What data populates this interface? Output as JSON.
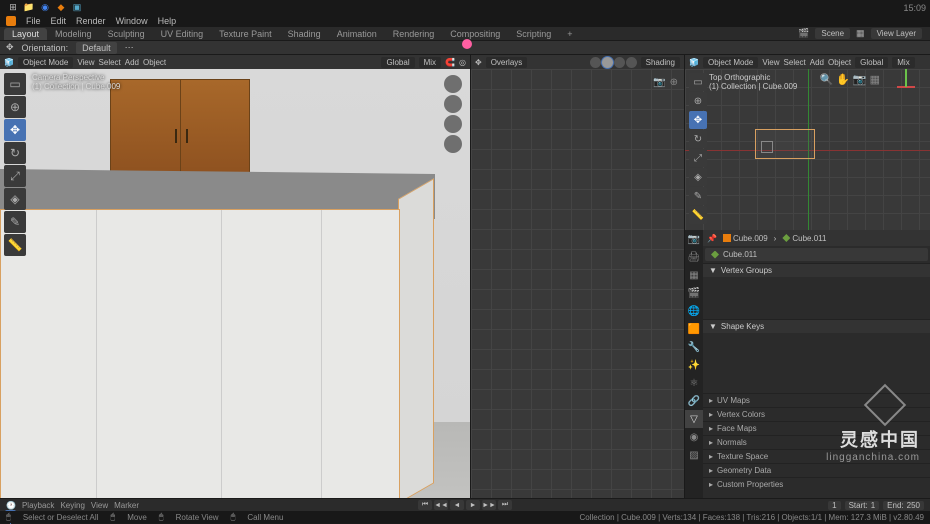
{
  "titlebar": {
    "clock": "15:09"
  },
  "menubar": {
    "items": [
      "File",
      "Edit",
      "Render",
      "Window",
      "Help"
    ]
  },
  "workspaces": {
    "tabs": [
      "Layout",
      "Modeling",
      "Sculpting",
      "UV Editing",
      "Texture Paint",
      "Shading",
      "Animation",
      "Rendering",
      "Compositing",
      "Scripting",
      "+"
    ],
    "active": "Layout",
    "scene_label": "Scene",
    "viewlayer_label": "View Layer"
  },
  "orientation": {
    "label": "Orientation:",
    "value": "Default"
  },
  "viewport_left": {
    "mode": "Object Mode",
    "menus": [
      "View",
      "Select",
      "Add",
      "Object"
    ],
    "overlay_title": "Camera Perspective",
    "overlay_sub": "(1) Collection | Cube.009",
    "global": "Global",
    "mix": "Mix"
  },
  "viewport_mid": {
    "overlays": "Overlays",
    "shading": "Shading"
  },
  "viewport_right": {
    "mode": "Object Mode",
    "menus": [
      "View",
      "Select",
      "Add",
      "Object"
    ],
    "global": "Global",
    "mix": "Mix",
    "overlay_title": "Top Orthographic",
    "overlay_sub": "(1) Collection | Cube.009"
  },
  "properties": {
    "breadcrumb_obj": "Cube.009",
    "breadcrumb_mesh": "Cube.011",
    "mesh_name": "Cube.011",
    "sections": {
      "vertex_groups": "Vertex Groups",
      "shape_keys": "Shape Keys",
      "uv_maps": "UV Maps",
      "vertex_colors": "Vertex Colors",
      "face_maps": "Face Maps",
      "normals": "Normals",
      "texture_space": "Texture Space",
      "geometry_data": "Geometry Data",
      "custom_properties": "Custom Properties"
    }
  },
  "timeline": {
    "menus": [
      "Playback",
      "Keying",
      "View",
      "Marker"
    ],
    "current_frame": "1",
    "start_label": "Start:",
    "start": "1",
    "end_label": "End:",
    "end": "250"
  },
  "statusbar": {
    "left_items": [
      "Select or Deselect All",
      "Move",
      "Rotate View",
      "Call Menu"
    ],
    "right": "Collection | Cube.009 | Verts:134 | Faces:138 | Tris:216 | Objects:1/1 | Mem: 127.3 MiB | v2.80.49"
  },
  "watermark": {
    "main": "灵感中国",
    "sub": "lingganchina.com"
  }
}
